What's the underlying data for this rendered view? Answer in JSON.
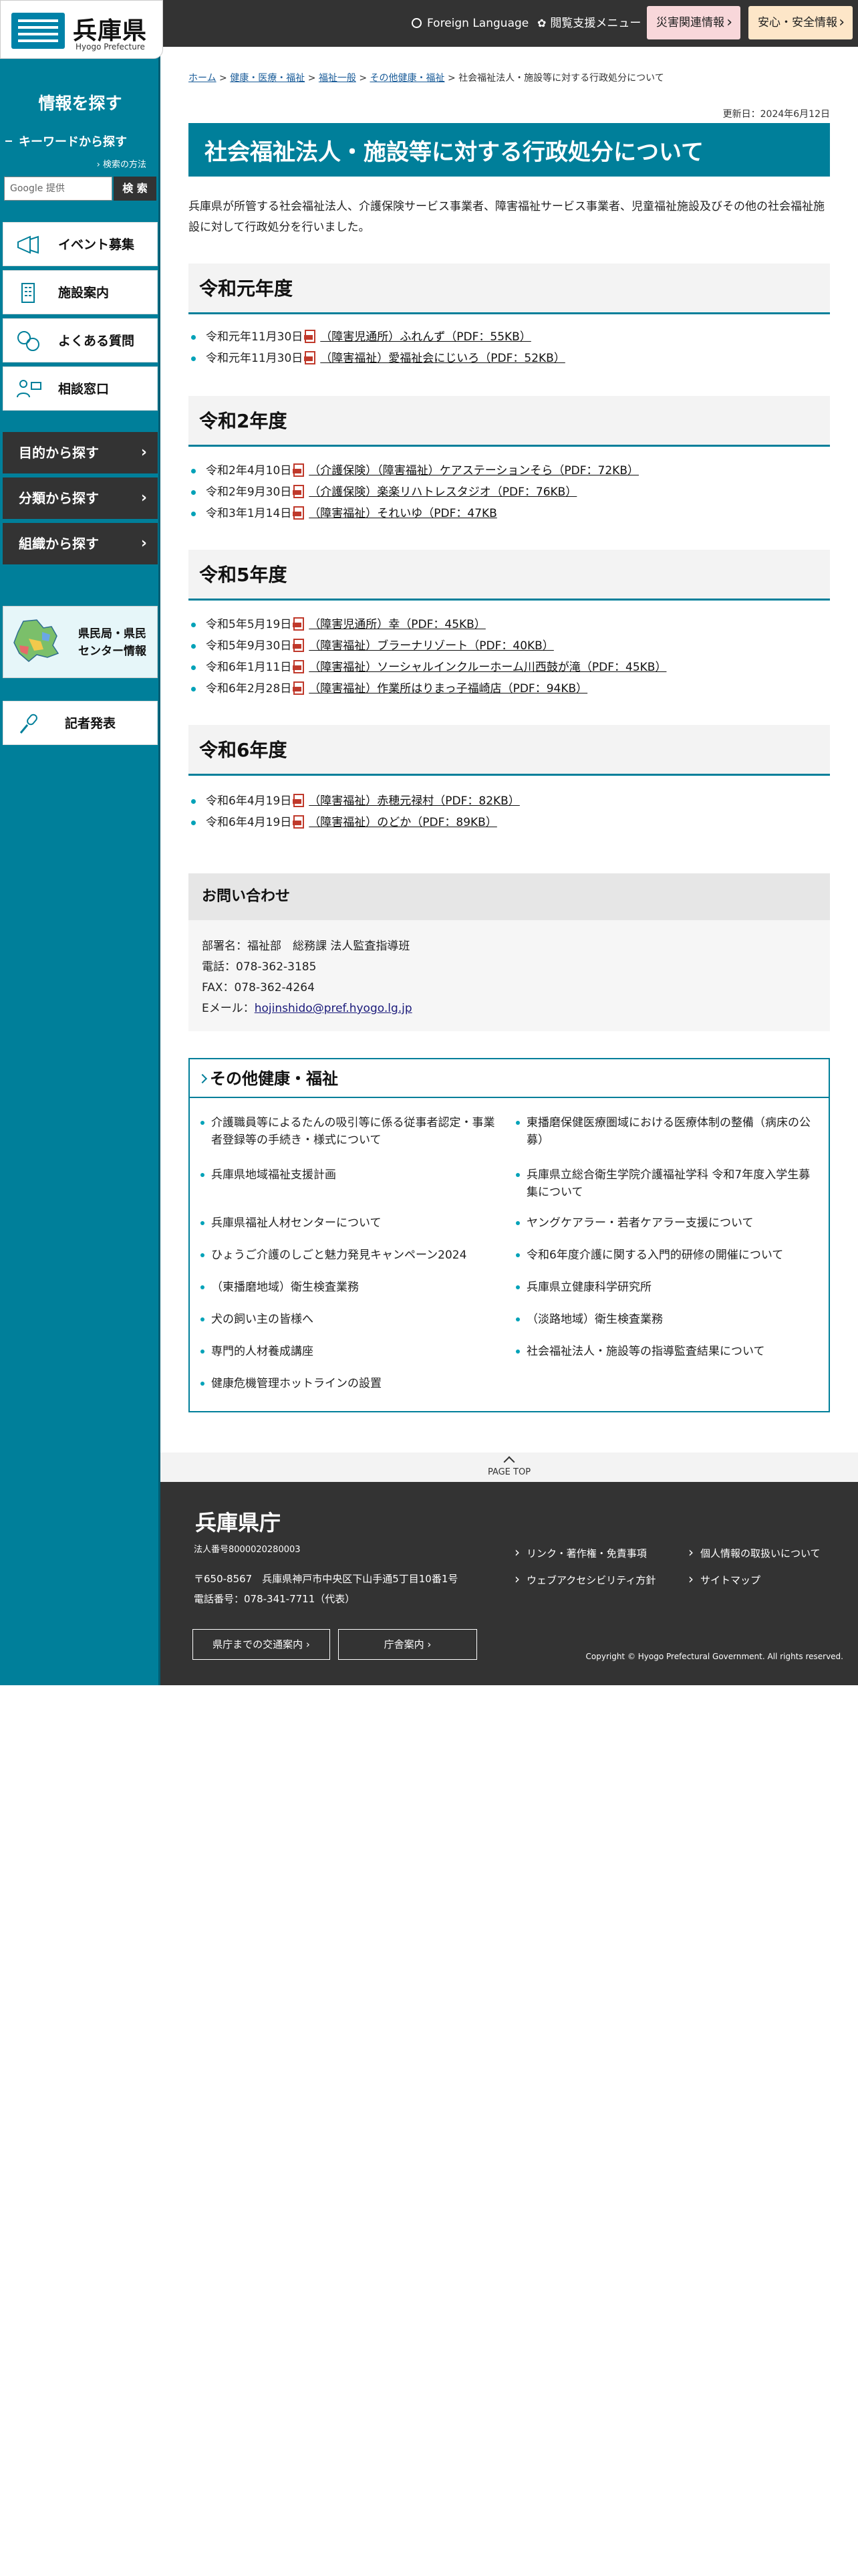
{
  "topbar": {
    "foreign_language": "Foreign Language",
    "browse_support": "閲覧支援メニュー",
    "disaster_info": "災害関連情報",
    "safety_info": "安心・安全情報"
  },
  "logo": {
    "name": "兵庫県",
    "sub": "Hyogo Prefecture"
  },
  "sidebar": {
    "heading": "情報を探す",
    "keyword_label": "キーワードから探す",
    "search_howto": "検索の方法",
    "search_placeholder": "Google 提供",
    "search_button": "検 索",
    "items": [
      {
        "label": "イベント募集"
      },
      {
        "label": "施設案内"
      },
      {
        "label": "よくある質問"
      },
      {
        "label": "相談窓口"
      }
    ],
    "dark_items": [
      {
        "label": "目的から探す"
      },
      {
        "label": "分類から探す"
      },
      {
        "label": "組織から探す"
      }
    ],
    "center_line1": "県民局・県民",
    "center_line2": "センター情報",
    "press_label": "記者発表"
  },
  "breadcrumb": {
    "items": [
      "ホーム",
      "健康・医療・福祉",
      "福祉一般",
      "その他健康・福祉"
    ],
    "separator": ">",
    "current": "社会福祉法人・施設等に対する行政処分について"
  },
  "updated": "更新日：2024年6月12日",
  "page_title": "社会福祉法人・施設等に対する行政処分について",
  "intro": "兵庫県が所管する社会福祉法人、介護保険サービス事業者、障害福祉サービス事業者、児童福祉施設及びその他の社会福祉施設に対して行政処分を行いました。",
  "sections": [
    {
      "heading": "令和元年度",
      "docs": [
        {
          "date": "令和元年11月30日",
          "link": "（障害児通所）ふれんず（PDF：55KB）"
        },
        {
          "date": "令和元年11月30日",
          "link": "（障害福祉）愛福祉会にじいろ（PDF：52KB）"
        }
      ]
    },
    {
      "heading": "令和2年度",
      "docs": [
        {
          "date": "令和2年4月10日",
          "link": "（介護保険）（障害福祉）ケアステーションそら（PDF：72KB）"
        },
        {
          "date": "令和2年9月30日",
          "link": "（介護保険）楽楽リハトレスタジオ（PDF：76KB）"
        },
        {
          "date": "令和3年1月14日",
          "link": "（障害福祉）それいゆ（PDF：47KB"
        }
      ]
    },
    {
      "heading": "令和5年度",
      "docs": [
        {
          "date": "令和5年5月19日",
          "link": "（障害児通所）幸（PDF：45KB）"
        },
        {
          "date": "令和5年9月30日",
          "link": "（障害福祉）ブラーナリゾート（PDF：40KB）"
        },
        {
          "date": "令和6年1月11日",
          "link": "（障害福祉）ソーシャルインクルーホーム川西鼓が滝（PDF：45KB）"
        },
        {
          "date": "令和6年2月28日",
          "link": "（障害福祉）作業所はりまっ子福崎店（PDF：94KB）"
        }
      ]
    },
    {
      "heading": "令和6年度",
      "docs": [
        {
          "date": "令和6年4月19日",
          "link": "（障害福祉）赤穂元禄村（PDF：82KB）"
        },
        {
          "date": "令和6年4月19日",
          "link": "（障害福祉）のどか（PDF：89KB）"
        }
      ]
    }
  ],
  "contact": {
    "heading": "お問い合わせ",
    "dept": "部署名：福祉部　総務課 法人監査指導班",
    "tel": "電話：078-362-3185",
    "fax": "FAX：078-362-4264",
    "email_label": "Eメール：",
    "email": "hojinshido@pref.hyogo.lg.jp"
  },
  "related": {
    "heading": "その他健康・福祉",
    "items": [
      "介護職員等によるたんの吸引等に係る従事者認定・事業者登録等の手続き・様式について",
      "東播磨保健医療圏域における医療体制の整備（病床の公募）",
      "兵庫県地域福祉支援計画",
      "兵庫県立総合衛生学院介護福祉学科 令和7年度入学生募集について",
      "兵庫県福祉人材センターについて",
      "ヤングケアラー・若者ケアラー支援について",
      "ひょうご介護のしごと魅力発見キャンペーン2024",
      "令和6年度介護に関する入門的研修の開催について",
      "（東播磨地域）衛生検査業務",
      "兵庫県立健康科学研究所",
      "犬の飼い主の皆様へ",
      "（淡路地域）衛生検査業務",
      "専門的人材養成講座",
      "社会福祉法人・施設等の指導監査結果について",
      "健康危機管理ホットラインの設置"
    ]
  },
  "page_top": "PAGE TOP",
  "footer": {
    "name": "兵庫県庁",
    "corp_no": "法人番号8000020280003",
    "address": "〒650-8567　兵庫県神戸市中央区下山手通5丁目10番1号",
    "phone": "電話番号：078-341-7711（代表）",
    "btn_access": "県庁までの交通案内",
    "btn_guide": "庁舎案内",
    "links": [
      "リンク・著作権・免責事項",
      "個人情報の取扱いについて",
      "ウェブアクセシビリティ方針",
      "サイトマップ"
    ],
    "copyright": "Copyright © Hyogo Prefectural Government. All rights reserved."
  },
  "colors": {
    "brand": "#007f9a",
    "dark": "#333333",
    "disaster": "#f8d7da",
    "safety": "#fde6c8"
  }
}
